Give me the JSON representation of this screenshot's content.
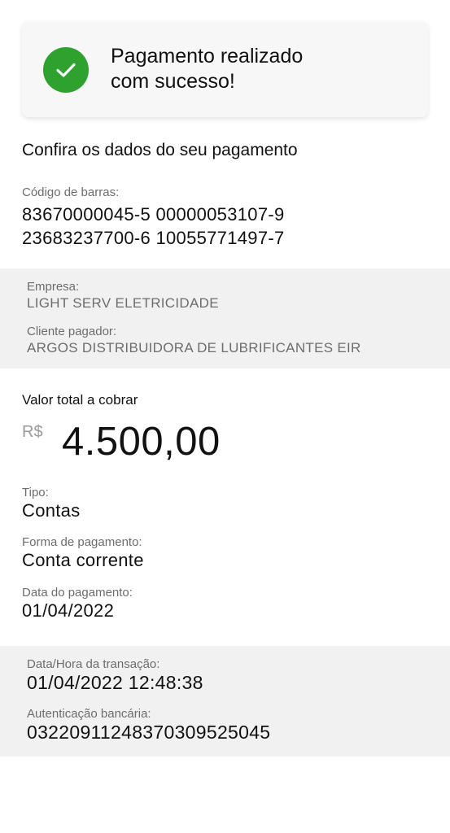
{
  "success": {
    "line1": "Pagamento realizado",
    "line2": "com sucesso!",
    "icon": "check-icon",
    "icon_color": "#2fa12f"
  },
  "section_title": "Confira os dados do seu pagamento",
  "barcode": {
    "label": "Código de barras:",
    "line1": "83670000045-5 00000053107-9",
    "line2": "23683237700-6 10055771497-7"
  },
  "company": {
    "label": "Empresa:",
    "value": "LIGHT SERV ELETRICIDADE"
  },
  "payer": {
    "label": "Cliente pagador:",
    "value": "ARGOS DISTRIBUIDORA DE LUBRIFICANTES EIR"
  },
  "total": {
    "label": "Valor total a cobrar",
    "currency": "R$",
    "amount": "4.500,00"
  },
  "type": {
    "label": "Tipo:",
    "value": "Contas"
  },
  "payment_method": {
    "label": "Forma de pagamento:",
    "value": "Conta corrente"
  },
  "payment_date": {
    "label": "Data do pagamento:",
    "value": "01/04/2022"
  },
  "transaction_datetime": {
    "label": "Data/Hora da transação:",
    "value": "01/04/2022 12:48:38"
  },
  "authentication": {
    "label": "Autenticação bancária:",
    "value": "032209112483703095250​45"
  }
}
